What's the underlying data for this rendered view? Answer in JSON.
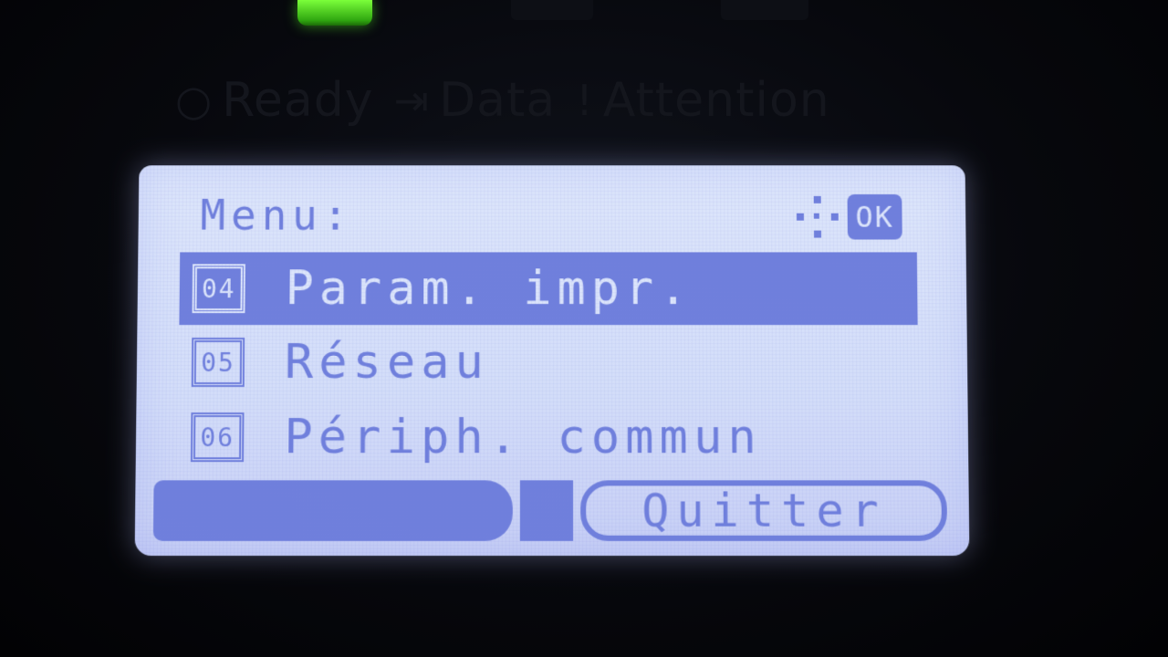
{
  "panel": {
    "indicators": [
      {
        "icon": "circle-icon",
        "label": "Ready"
      },
      {
        "icon": "data-icon",
        "label": "Data"
      },
      {
        "icon": "exclamation-icon",
        "label": "Attention"
      }
    ]
  },
  "screen": {
    "title": "Menu:",
    "ok_label": "OK",
    "items": [
      {
        "number": "04",
        "label": "Param. impr.",
        "selected": true
      },
      {
        "number": "05",
        "label": "Réseau",
        "selected": false
      },
      {
        "number": "06",
        "label": "Périph. commun",
        "selected": false
      }
    ],
    "softkeys": {
      "left_label": "",
      "right_label": "Quitter"
    }
  },
  "colors": {
    "lcd_background": "#d3ddf9",
    "lcd_ink": "#6f7fdc",
    "status_key": "#4fd61f"
  }
}
